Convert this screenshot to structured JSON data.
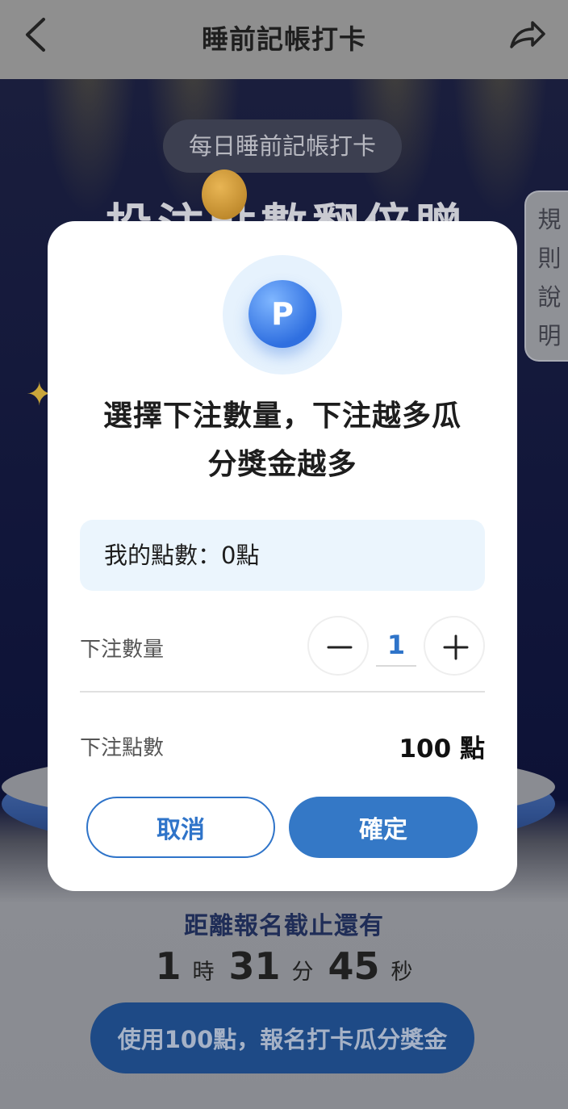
{
  "header": {
    "title": "睡前記帳打卡",
    "back_icon": "chevron-left-icon",
    "share_icon": "share-icon"
  },
  "background": {
    "tag": "每日睡前記帳打卡",
    "banner_title": "投注點數翻倍贈",
    "rules_tab": [
      "規",
      "則",
      "說",
      "明"
    ],
    "deadline_label": "距離報名截止還有",
    "countdown": {
      "hours": "1",
      "hours_unit": "時",
      "minutes": "31",
      "minutes_unit": "分",
      "seconds": "45",
      "seconds_unit": "秒"
    },
    "signup_button": "使用100點，報名打卡瓜分獎金"
  },
  "modal": {
    "icon_letter": "P",
    "title_line1": "選擇下注數量，下注越多瓜",
    "title_line2": "分獎金越多",
    "my_points": "我的點數：0點",
    "quantity_label": "下注數量",
    "quantity_value": "1",
    "bet_points_label": "下注點數",
    "bet_points_value": "100 點",
    "cancel_label": "取消",
    "confirm_label": "確定"
  },
  "colors": {
    "accent": "#3478c6",
    "modal_bg": "#ffffff",
    "points_box_bg": "#ebf5fd",
    "scene_dark": "#11163a"
  }
}
